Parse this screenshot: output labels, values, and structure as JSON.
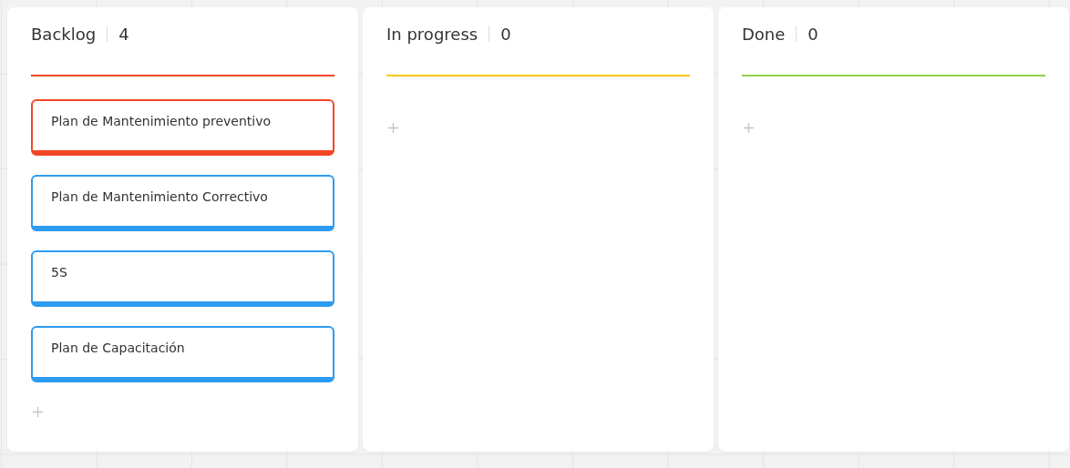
{
  "columns": [
    {
      "title": "Backlog",
      "count": "4",
      "color": "#f24726",
      "cards": [
        {
          "text": "Plan de Mantenimiento preventivo",
          "color": "#f24726"
        },
        {
          "text": "Plan de Mantenimiento Correctivo",
          "color": "#2d9bf0"
        },
        {
          "text": "5S",
          "color": "#2d9bf0"
        },
        {
          "text": "Plan de Capacitación",
          "color": "#2d9bf0"
        }
      ]
    },
    {
      "title": "In progress",
      "count": "0",
      "color": "#fac710"
    },
    {
      "title": "Done",
      "count": "0",
      "color": "#8fd14f"
    }
  ]
}
